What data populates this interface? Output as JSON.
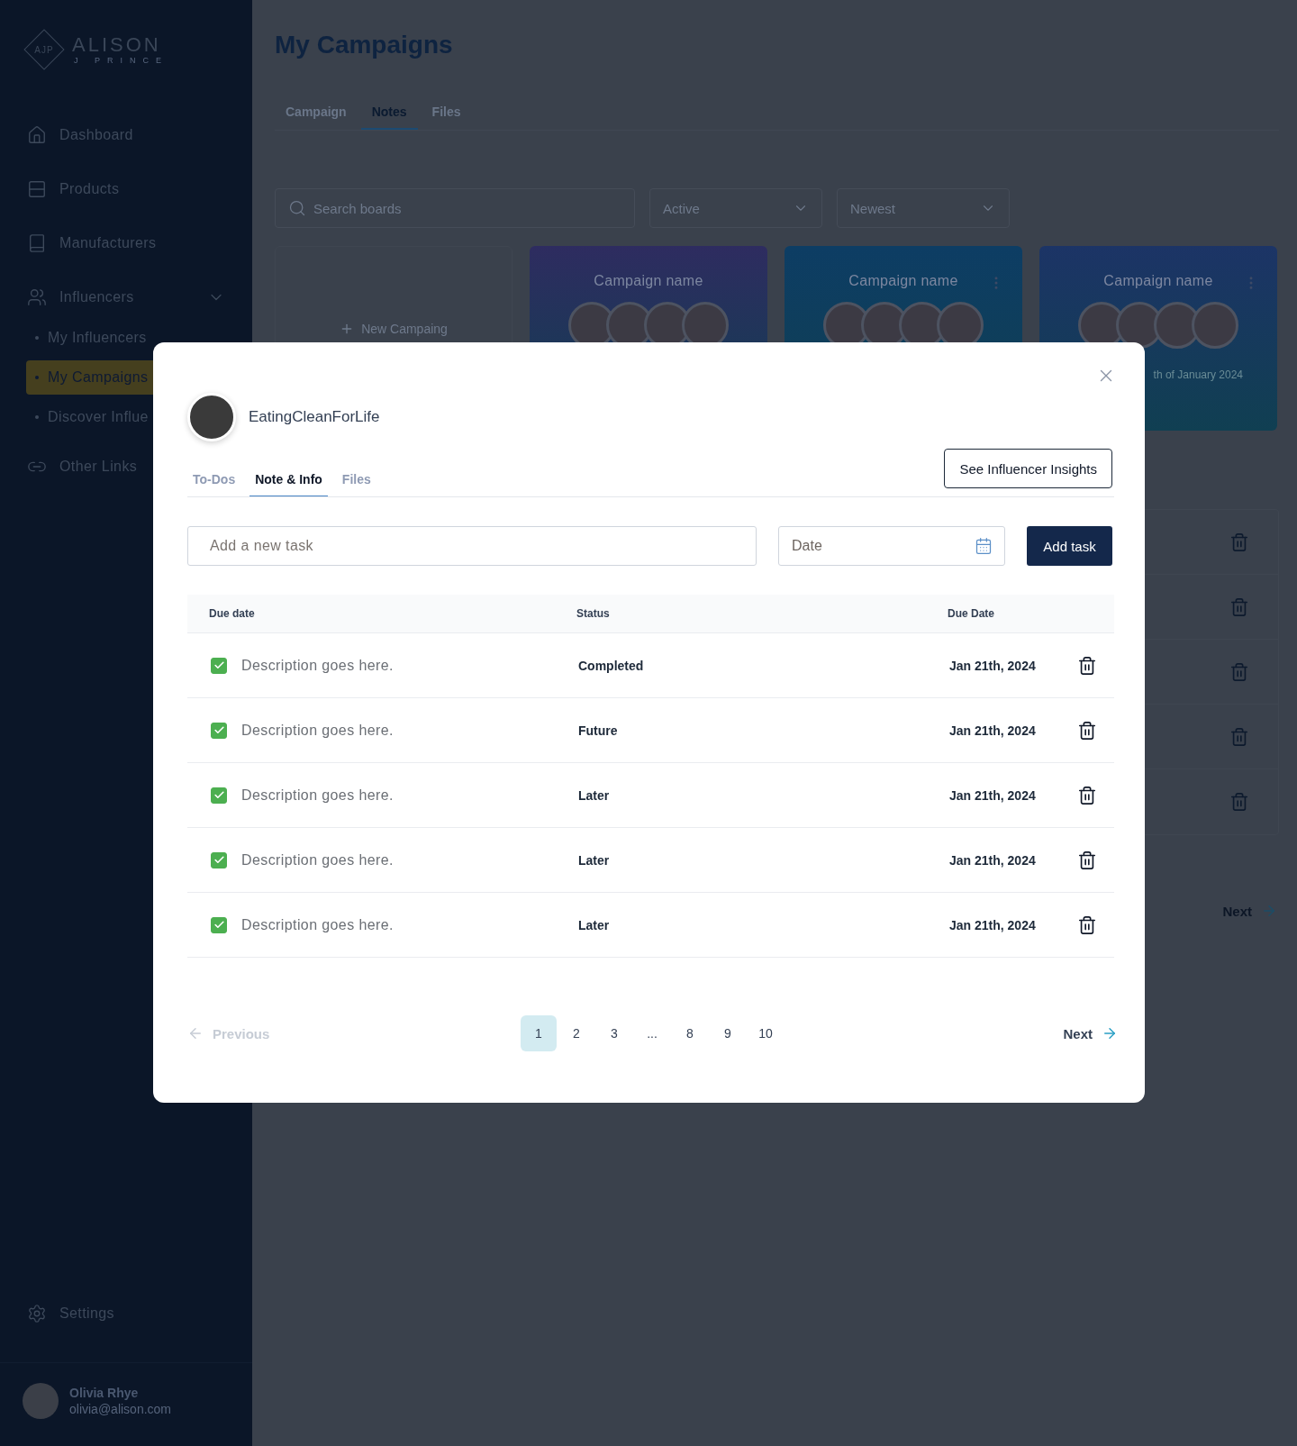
{
  "sidebar": {
    "logo": {
      "mark": "AJP",
      "name": "ALISON",
      "subtitle": "J PRINCE"
    },
    "items": [
      {
        "label": "Dashboard",
        "selected": false
      },
      {
        "label": "Products",
        "selected": false
      },
      {
        "label": "Manufacturers",
        "selected": false
      },
      {
        "label": "Influencers",
        "selected": false,
        "expanded": true,
        "children": [
          {
            "label": "My Influencers",
            "selected": false
          },
          {
            "label": "My Campaigns",
            "selected": true
          },
          {
            "label": "Discover Influe",
            "selected": false
          }
        ]
      },
      {
        "label": "Other Links",
        "selected": false
      }
    ],
    "settings": "Settings",
    "user": {
      "name": "Olivia Rhye",
      "email": "olivia@alison.com"
    }
  },
  "page": {
    "title": "My Campaigns",
    "tabs": [
      {
        "label": "Campaign",
        "selected": false
      },
      {
        "label": "Notes",
        "selected": true
      },
      {
        "label": "Files",
        "selected": false
      }
    ],
    "search": {
      "placeholder": "Search boards"
    },
    "filters": [
      {
        "value": "Active"
      },
      {
        "value": "Newest"
      }
    ],
    "new_campaign": "New Campaing",
    "cards": [
      {
        "title": "Campaign name",
        "color": "#2e2c60",
        "menu": false
      },
      {
        "title": "Campaign name",
        "color": "#0d3d64",
        "menu": true
      },
      {
        "title": "Campaign name",
        "color": "#1c3466",
        "menu": true,
        "date": "th of January 2024"
      }
    ],
    "next": "Next"
  },
  "modal": {
    "influencer": "EatingCleanForLife",
    "insights_button": "See Influencer Insights",
    "tabs": [
      {
        "label": "To-Dos",
        "selected": false
      },
      {
        "label": "Note & Info",
        "selected": true
      },
      {
        "label": "Files",
        "selected": false
      }
    ],
    "task_input": {
      "placeholder": "Add a new task"
    },
    "date_input": {
      "placeholder": "Date"
    },
    "add_button": "Add task",
    "columns": [
      "Due date",
      "Status",
      "Due Date"
    ],
    "rows": [
      {
        "checked": true,
        "description": "Description goes here.",
        "status": "Completed",
        "due": "Jan 21th, 2024"
      },
      {
        "checked": true,
        "description": "Description goes here.",
        "status": "Future",
        "due": "Jan 21th, 2024"
      },
      {
        "checked": true,
        "description": "Description goes here.",
        "status": "Later",
        "due": "Jan 21th, 2024"
      },
      {
        "checked": true,
        "description": "Description goes here.",
        "status": "Later",
        "due": "Jan 21th, 2024"
      },
      {
        "checked": true,
        "description": "Description goes here.",
        "status": "Later",
        "due": "Jan 21th, 2024"
      }
    ],
    "pagination": {
      "previous": {
        "label": "Previous",
        "disabled": true
      },
      "pages": [
        {
          "label": "1",
          "selected": true
        },
        {
          "label": "2",
          "selected": false
        },
        {
          "label": "3",
          "selected": false
        },
        {
          "label": "...",
          "selected": false
        },
        {
          "label": "8",
          "selected": false
        },
        {
          "label": "9",
          "selected": false
        },
        {
          "label": "10",
          "selected": false
        }
      ],
      "next": {
        "label": "Next",
        "disabled": false
      }
    }
  }
}
